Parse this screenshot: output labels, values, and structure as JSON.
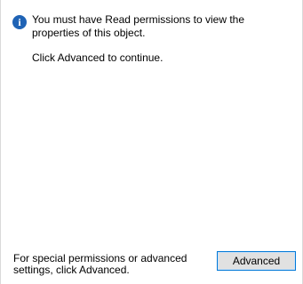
{
  "icon": {
    "name": "info-icon",
    "glyph": "i",
    "color": "#1f63b5"
  },
  "message": "You must have Read permissions to view the properties of this object.",
  "hint": "Click Advanced to continue.",
  "footer": {
    "text": "For special permissions or advanced settings, click Advanced.",
    "advanced_button_label": "Advanced"
  }
}
